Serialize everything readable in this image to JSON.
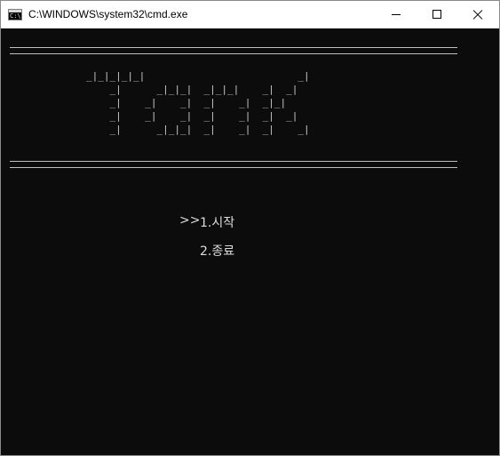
{
  "window": {
    "title": "C:\\WINDOWS\\system32\\cmd.exe",
    "icon": "cmd-icon",
    "icon_text": "C:\\."
  },
  "console": {
    "background": "#0c0c0c",
    "foreground": "#cccccc",
    "banner_ascii": "_|_|_|_|_|                          _|\n    _|      _|_|_|  _|_|_|    _|  _|\n    _|    _|    _|  _|    _|  _|_|\n    _|    _|    _|  _|    _|  _|  _|\n    _|      _|_|_|  _|    _|  _|    _|",
    "menu": {
      "cursor": ">>",
      "items": [
        {
          "label": "1.시작"
        },
        {
          "label": "2.종료"
        }
      ]
    }
  }
}
